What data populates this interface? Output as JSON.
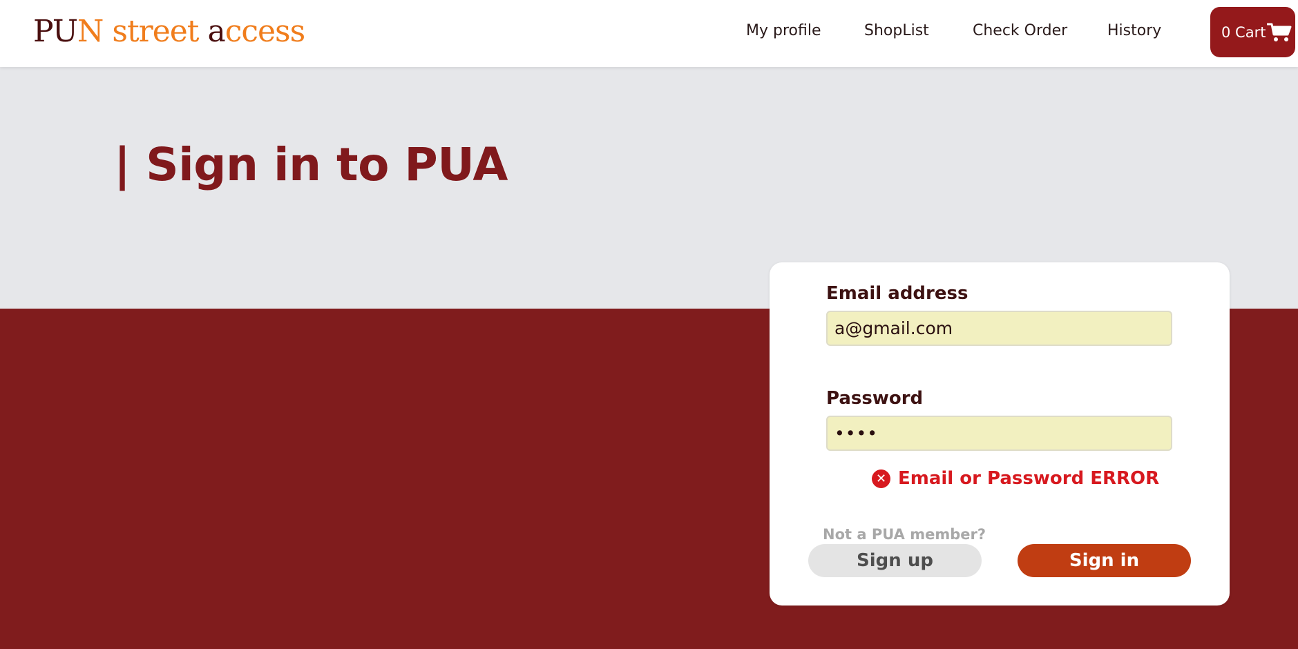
{
  "brand": {
    "logo_parts": [
      {
        "text": "PU",
        "tone": "dark"
      },
      {
        "text": "N street ",
        "tone": "orange"
      },
      {
        "text": "a",
        "tone": "dark"
      },
      {
        "text": "ccess",
        "tone": "orange"
      }
    ]
  },
  "nav": {
    "items": [
      {
        "label": "My profile"
      },
      {
        "label": "ShopList"
      },
      {
        "label": "Check Order"
      },
      {
        "label": "History"
      }
    ],
    "cart": {
      "label": "0 Cart",
      "icon": "cart-icon"
    }
  },
  "page": {
    "title": "| Sign in to PUA"
  },
  "form": {
    "email": {
      "label": "Email address",
      "value": "a@gmail.com"
    },
    "password": {
      "label": "Password",
      "value": "••••"
    },
    "error": {
      "icon": "error-x-icon",
      "text": "Email or Password ERROR"
    },
    "member_note": "Not a PUA member?",
    "signup_label": "Sign up",
    "signin_label": "Sign in"
  },
  "colors": {
    "brand_dark": "#4a0f0f",
    "brand_orange": "#f07d1c",
    "maroon": "#801c1d",
    "cart_red": "#94191b",
    "signin_orange": "#c03d12",
    "error_red": "#d7191f",
    "input_bg": "#f2f0c0"
  }
}
